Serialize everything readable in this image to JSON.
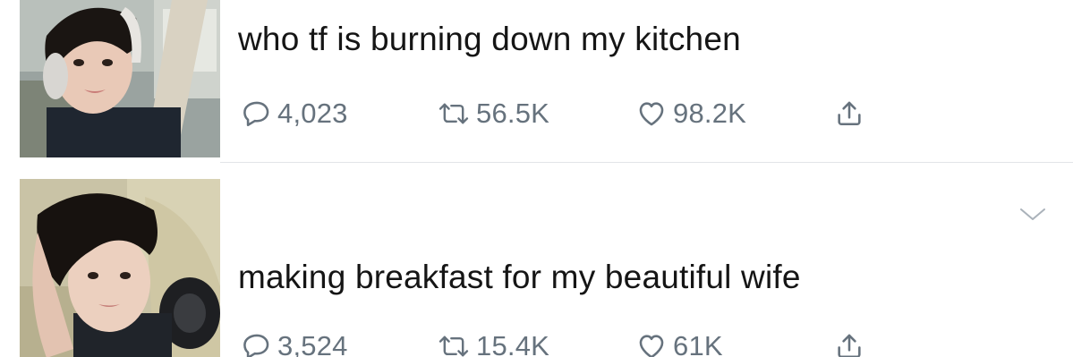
{
  "feed": {
    "tweets": [
      {
        "text": "who tf is burning down my kitchen",
        "replies": "4,023",
        "retweets": "56.5K",
        "likes": "98.2K",
        "show_caret": false
      },
      {
        "text": "making breakfast for my beautiful wife",
        "replies": "3,524",
        "retweets": "15.4K",
        "likes": "61K",
        "show_caret": true
      }
    ],
    "icons": {
      "reply": "speech-bubble-icon",
      "retweet": "retweet-arrows-icon",
      "like": "heart-icon",
      "share": "share-upload-icon",
      "more": "chevron-down-icon"
    },
    "colors": {
      "text": "#151515",
      "meta": "#66727d",
      "divider": "#e2e5e8",
      "background": "#ffffff"
    }
  }
}
